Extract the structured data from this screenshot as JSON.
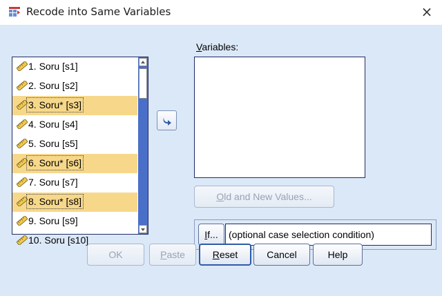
{
  "window": {
    "title": "Recode into Same Variables",
    "close_glyph": "×"
  },
  "source_list": {
    "items": [
      {
        "label": "1. Soru [s1]",
        "highlighted": false
      },
      {
        "label": "2. Soru [s2]",
        "highlighted": false
      },
      {
        "label": "3. Soru* [s3]",
        "highlighted": true
      },
      {
        "label": "4. Soru [s4]",
        "highlighted": false
      },
      {
        "label": "5. Soru [s5]",
        "highlighted": false
      },
      {
        "label": "6. Soru* [s6]",
        "highlighted": true
      },
      {
        "label": "7. Soru [s7]",
        "highlighted": false
      },
      {
        "label": "8. Soru* [s8]",
        "highlighted": true
      },
      {
        "label": "9. Soru [s9]",
        "highlighted": false
      },
      {
        "label": "10. Soru [s10]",
        "highlighted": false
      }
    ],
    "item_icon": "ruler-icon"
  },
  "move_button": {
    "icon": "arrow-right-icon"
  },
  "variables": {
    "label_accesskey": "V",
    "label_rest": "ariables:"
  },
  "buttons": {
    "old_new": "Old and New Values...",
    "old_new_accesskey": "O",
    "old_new_rest": "ld and New Values...",
    "if_accesskey": "I",
    "if_rest": "f...",
    "if_condition": "(optional case selection condition)",
    "ok": "OK",
    "paste_accesskey": "P",
    "paste_rest": "aste",
    "reset_accesskey": "R",
    "reset_rest": "eset",
    "cancel": "Cancel",
    "help": "Help"
  },
  "colors": {
    "dialog_bg": "#dbe8f7",
    "highlight": "#f7d88a",
    "scrollbar": "#4a6fc9",
    "default_button_border": "#2f5aa8"
  }
}
